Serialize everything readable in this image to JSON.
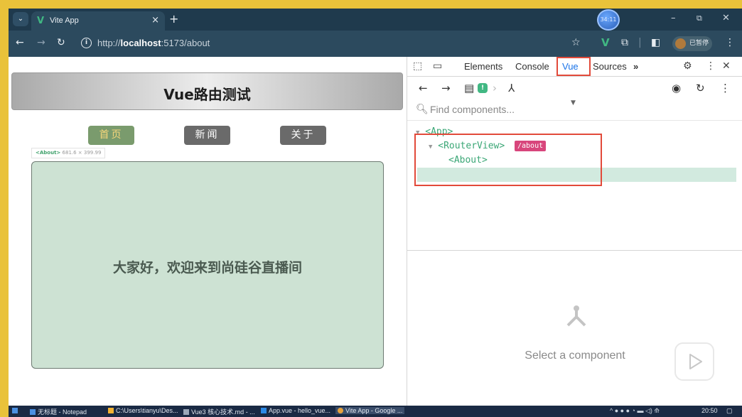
{
  "browser": {
    "tab_title": "Vite App",
    "tab_logo": "V",
    "new_tab": "+",
    "tab_close": "×",
    "tab_menu": "⌄",
    "clock_badge": "34:11",
    "window_controls": {
      "minimize": "–",
      "maximize": "⧉",
      "close": "✕"
    },
    "url_prefix": "http://",
    "url_host": "localhost",
    "url_path": ":5173/about",
    "profile_label": "已暂停",
    "icons": [
      "back-icon",
      "forward-icon",
      "reload-icon",
      "info-icon",
      "star-icon",
      "vue-devtools-icon",
      "extensions-icon",
      "sidepanel-icon",
      "menu-icon"
    ]
  },
  "page": {
    "header_title": "Vue路由测试",
    "nav": [
      {
        "label": "首页",
        "active": true
      },
      {
        "label": "新闻",
        "active": false
      },
      {
        "label": "关于",
        "active": false
      }
    ],
    "component_label_name": "<About>",
    "component_label_size": "681.6 × 399.99",
    "about_text": "大家好，欢迎来到尚硅谷直播间",
    "colors": {
      "active_nav_bg": "#7a9b6d",
      "active_nav_text": "#f6d67a",
      "about_bg": "#cde2d3"
    }
  },
  "devtools": {
    "tabs": [
      {
        "label": "Elements"
      },
      {
        "label": "Console"
      },
      {
        "label": "Vue"
      },
      {
        "label": "Sources"
      }
    ],
    "more_tabs": "»",
    "search_placeholder": "Find components...",
    "tree": [
      {
        "label": "<App>",
        "toggle": "▼"
      },
      {
        "label": "<RouterView>",
        "toggle": "▼",
        "tag": "/about"
      },
      {
        "label": "<About>",
        "toggle": ""
      }
    ],
    "empty_state": "Select a component",
    "accent_color": "#41b883"
  },
  "taskbar": {
    "items": [
      {
        "label": "无标题 - Notepad",
        "color": "#4a90e2"
      },
      {
        "label": "C:\\Users\\tianyu\\Des...",
        "color": "#f2b233"
      },
      {
        "label": "Vue3 核心技术.md - ...",
        "color": "#9aa7b8"
      },
      {
        "label": "App.vue - hello_vue...",
        "color": "#2d8ae6"
      },
      {
        "label": "Vite App - Google ...",
        "color": "#e6a23c"
      }
    ],
    "time": "20:50"
  }
}
